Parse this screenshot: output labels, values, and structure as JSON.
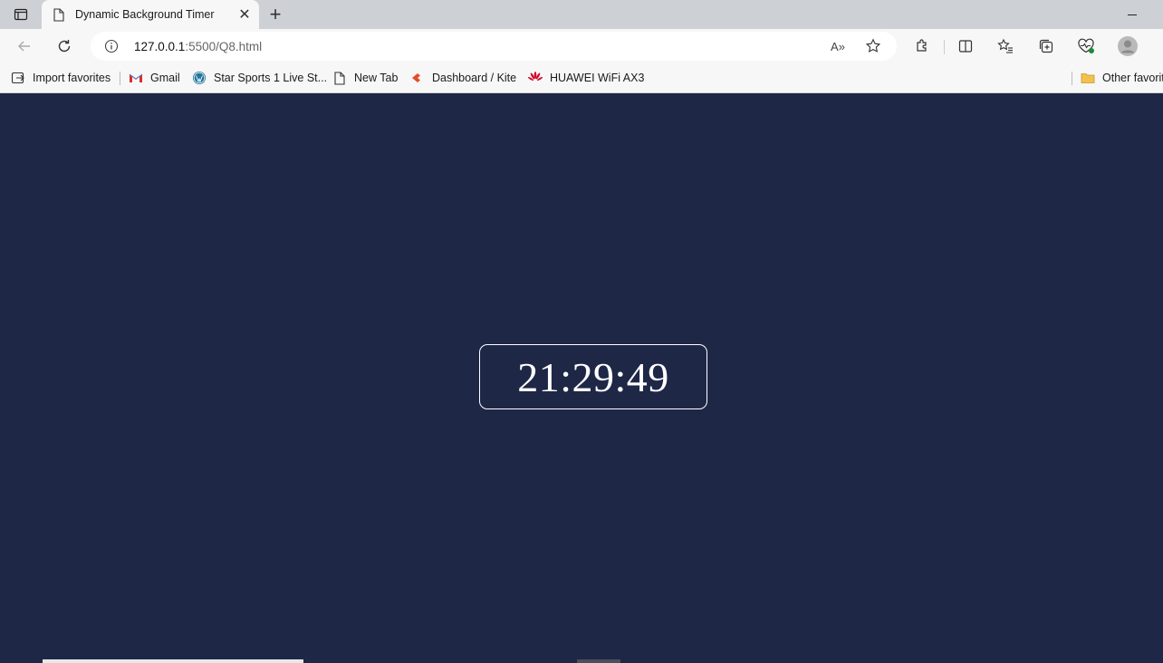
{
  "tab": {
    "title": "Dynamic Background Timer",
    "close_glyph": "✕",
    "new_tab_glyph": "+"
  },
  "address": {
    "host": "127.0.0.1",
    "path": ":5500/Q8.html",
    "read_aloud": "A»"
  },
  "favorites": {
    "items": [
      {
        "label": "Import favorites",
        "icon": "import-icon"
      },
      {
        "label": "Gmail",
        "icon": "gmail-icon"
      },
      {
        "label": "Star Sports 1 Live St...",
        "icon": "wordpress-icon"
      },
      {
        "label": "New Tab",
        "icon": "page-icon"
      },
      {
        "label": "Dashboard / Kite",
        "icon": "kite-icon"
      },
      {
        "label": "HUAWEI WiFi AX3",
        "icon": "huawei-icon"
      }
    ],
    "other": "Other favorites"
  },
  "page": {
    "timer": "21:29:49",
    "background_color": "#1f2747"
  }
}
